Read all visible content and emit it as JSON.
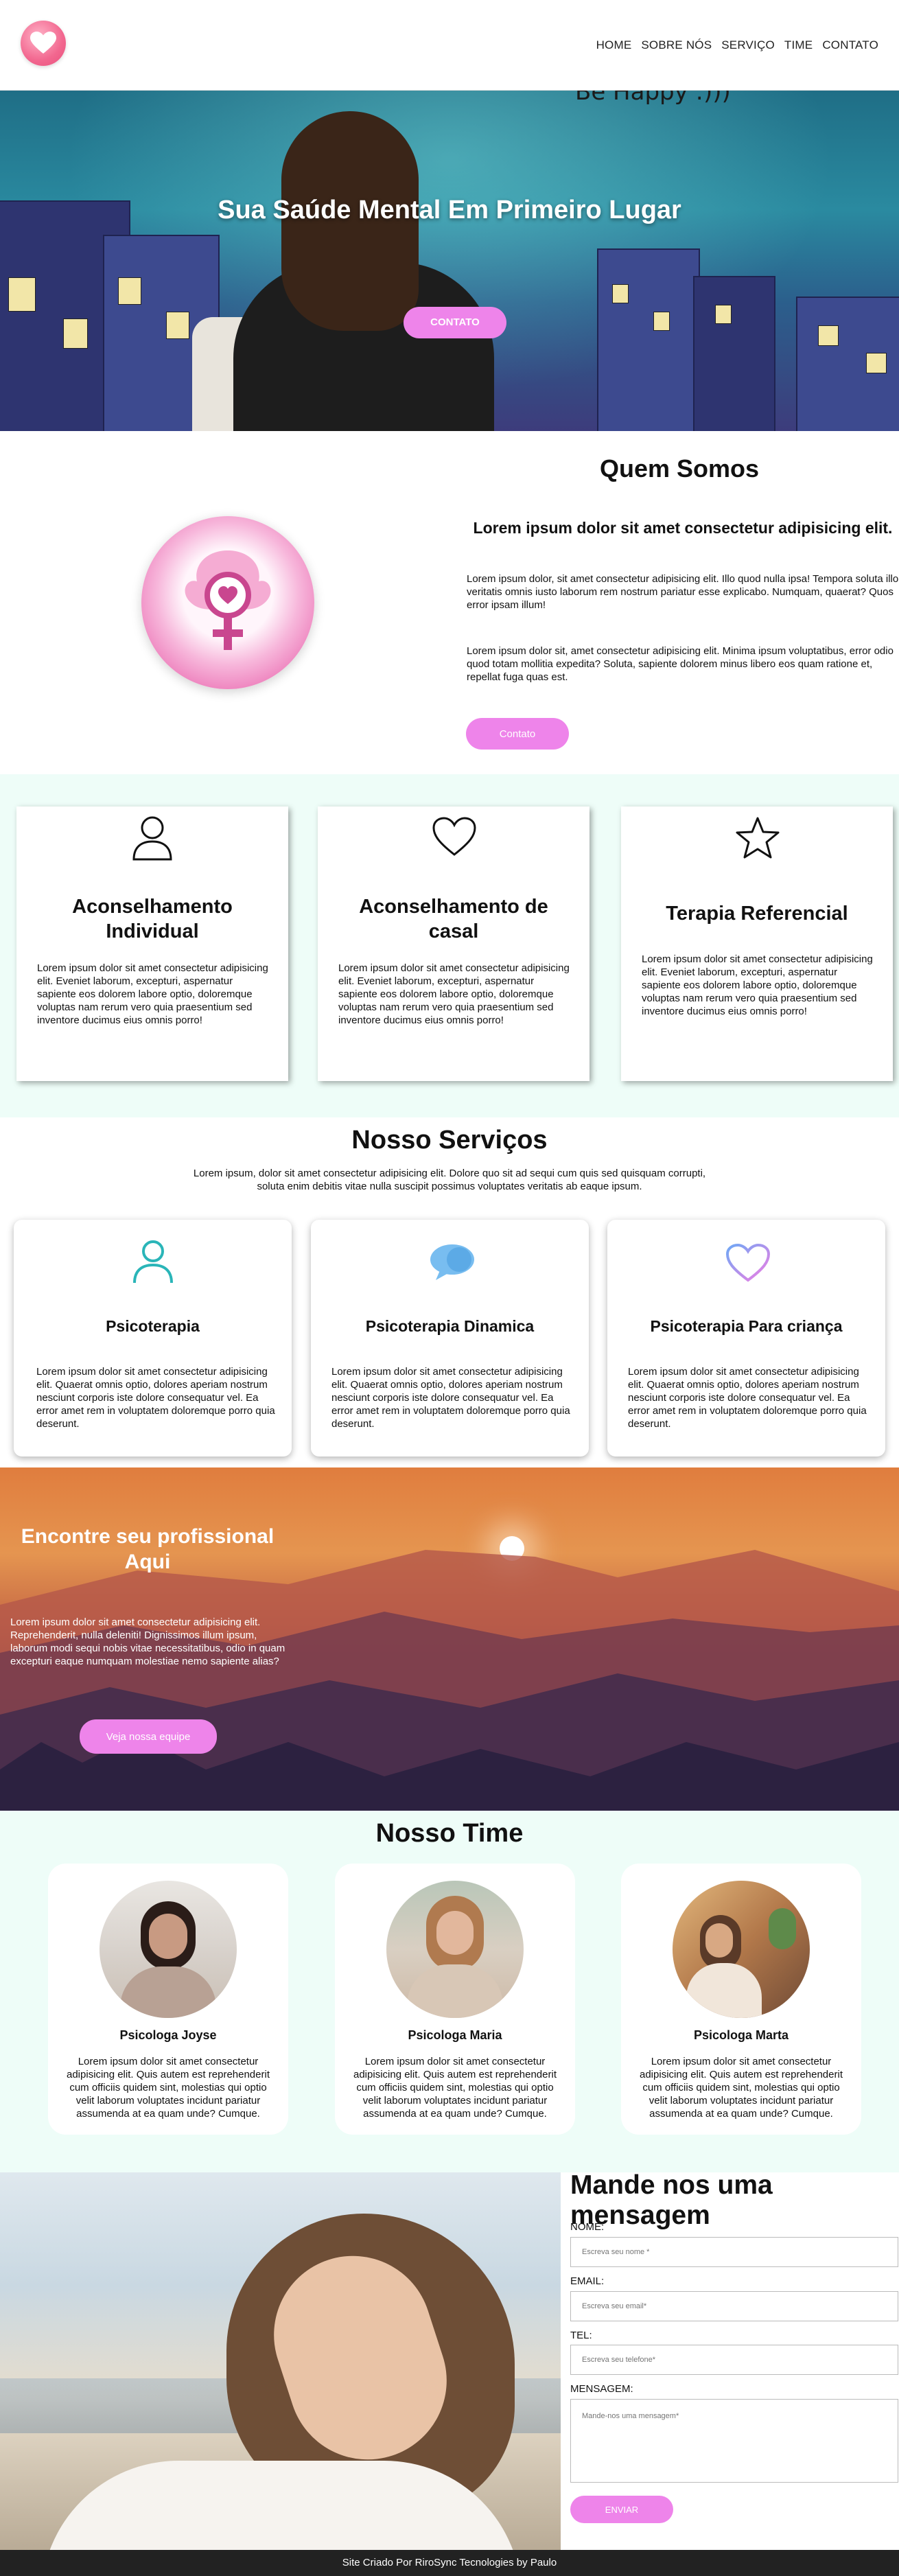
{
  "header": {
    "nav": [
      "HOME",
      "SOBRE NÓS",
      "SERVIÇO",
      "TIME",
      "CONTATO"
    ]
  },
  "hero": {
    "title": "Sua Saúde Mental Em Primeiro Lugar",
    "scribble": "Be Happy :)))",
    "button": "CONTATO"
  },
  "about": {
    "title": "Quem Somos",
    "subtitle": "Lorem ipsum dolor sit amet consectetur adipisicing elit.",
    "p1": "Lorem ipsum dolor, sit amet consectetur adipisicing elit. Illo quod nulla ipsa! Tempora soluta illo veritatis omnis iusto laborum rem nostrum pariatur esse explicabo. Numquam, quaerat? Quos error ipsam illum!",
    "p2": "Lorem ipsum dolor sit, amet consectetur adipisicing elit. Minima ipsum voluptatibus, error odio quod totam mollitia expedita? Soluta, sapiente dolorem minus libero eos quam ratione et, repellat fuga quas est.",
    "button": "Contato"
  },
  "features": [
    {
      "icon": "person-icon",
      "title": "Aconselhamento Individual",
      "text": "Lorem ipsum dolor sit amet consectetur adipisicing elit. Eveniet laborum, excepturi, aspernatur sapiente eos dolorem labore optio, doloremque voluptas nam rerum vero quia praesentium sed inventore ducimus eius omnis porro!"
    },
    {
      "icon": "heart-icon",
      "title": "Aconselhamento de casal",
      "text": "Lorem ipsum dolor sit amet consectetur adipisicing elit. Eveniet laborum, excepturi, aspernatur sapiente eos dolorem labore optio, doloremque voluptas nam rerum vero quia praesentium sed inventore ducimus eius omnis porro!"
    },
    {
      "icon": "star-icon",
      "title": "Terapia Referencial",
      "text": "Lorem ipsum dolor sit amet consectetur adipisicing elit. Eveniet laborum, excepturi, aspernatur sapiente eos dolorem labore optio, doloremque voluptas nam rerum vero quia praesentium sed inventore ducimus eius omnis porro!"
    }
  ],
  "services": {
    "title": "Nosso Serviços",
    "intro": "Lorem ipsum, dolor sit amet consectetur adipisicing elit. Dolore quo sit ad sequi cum quis sed quisquam corrupti, soluta enim debitis vitae nulla suscipit possimus voluptates veritatis ab eaque ipsum.",
    "items": [
      {
        "icon": "person-icon",
        "title": "Psicoterapia",
        "text": "Lorem ipsum dolor sit amet consectetur adipisicing elit. Quaerat omnis optio, dolores aperiam nostrum nesciunt corporis iste dolore consequatur vel. Ea error amet rem in voluptatem doloremque porro quia deserunt."
      },
      {
        "icon": "chat-bubble-icon",
        "title": "Psicoterapia Dinamica",
        "text": "Lorem ipsum dolor sit amet consectetur adipisicing elit. Quaerat omnis optio, dolores aperiam nostrum nesciunt corporis iste dolore consequatur vel. Ea error amet rem in voluptatem doloremque porro quia deserunt."
      },
      {
        "icon": "heart-icon",
        "title": "Psicoterapia Para criança",
        "text": "Lorem ipsum dolor sit amet consectetur adipisicing elit. Quaerat omnis optio, dolores aperiam nostrum nesciunt corporis iste dolore consequatur vel. Ea error amet rem in voluptatem doloremque porro quia deserunt."
      }
    ]
  },
  "find": {
    "title": "Encontre seu profissional Aqui",
    "text": "Lorem ipsum dolor sit amet consectetur adipisicing elit. Reprehenderit, nulla deleniti! Dignissimos illum ipsum, laborum modi sequi nobis vitae necessitatibus, odio in quam excepturi eaque numquam molestiae nemo sapiente alias?",
    "button": "Veja nossa equipe"
  },
  "team": {
    "title": "Nosso Time",
    "members": [
      {
        "name": "Psicologa Joyse",
        "text": "Lorem ipsum dolor sit amet consectetur adipisicing elit. Quis autem est reprehenderit cum officiis quidem sint, molestias qui optio velit laborum voluptates incidunt pariatur assumenda at ea quam unde? Cumque."
      },
      {
        "name": "Psicologa Maria",
        "text": "Lorem ipsum dolor sit amet consectetur adipisicing elit. Quis autem est reprehenderit cum officiis quidem sint, molestias qui optio velit laborum voluptates incidunt pariatur assumenda at ea quam unde? Cumque."
      },
      {
        "name": "Psicologa Marta",
        "text": "Lorem ipsum dolor sit amet consectetur adipisicing elit. Quis autem est reprehenderit cum officiis quidem sint, molestias qui optio velit laborum voluptates incidunt pariatur assumenda at ea quam unde? Cumque."
      }
    ]
  },
  "contact": {
    "title": "Mande nos uma mensagem",
    "name_label": "NOME:",
    "name_placeholder": "Escreva seu nome *",
    "email_label": "EMAIL:",
    "email_placeholder": "Escreva seu email*",
    "tel_label": "TEL:",
    "tel_placeholder": "Escreva seu telefone*",
    "message_label": "MENSAGEM:",
    "message_placeholder": "Mande-nos uma mensagem*",
    "button": "ENVIAR"
  },
  "footer": {
    "text": "Site Criado Por RiroSync Tecnologies by Paulo"
  },
  "colors": {
    "accent": "#ee84ea",
    "mint": "#eefdf8",
    "footer": "#222222"
  }
}
